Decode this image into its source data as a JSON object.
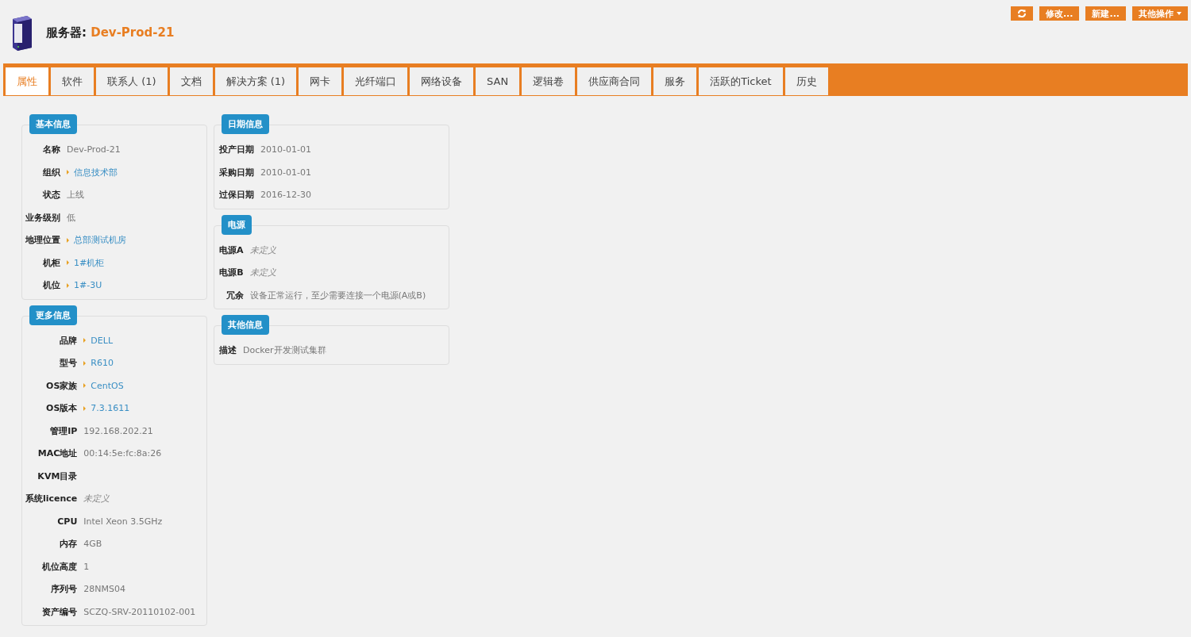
{
  "header": {
    "label": "服务器:",
    "name": "Dev-Prod-21"
  },
  "actions": [
    {
      "kind": "icon"
    },
    {
      "kind": "text",
      "label": "修改..."
    },
    {
      "kind": "text",
      "label": "新建..."
    },
    {
      "kind": "menu",
      "label": "其他操作"
    }
  ],
  "tabs": [
    {
      "label": "属性",
      "selected": true
    },
    {
      "label": "软件",
      "selected": false
    },
    {
      "label": "联系人 (1)",
      "selected": false
    },
    {
      "label": "文档",
      "selected": false
    },
    {
      "label": "解决方案 (1)",
      "selected": false
    },
    {
      "label": "网卡",
      "selected": false
    },
    {
      "label": "光纤端口",
      "selected": false
    },
    {
      "label": "网络设备",
      "selected": false
    },
    {
      "label": "SAN",
      "selected": false
    },
    {
      "label": "逻辑卷",
      "selected": false
    },
    {
      "label": "供应商合同",
      "selected": false
    },
    {
      "label": "服务",
      "selected": false
    },
    {
      "label": "活跃的Ticket",
      "selected": false
    },
    {
      "label": "历史",
      "selected": false
    }
  ],
  "columns": [
    [
      {
        "title": "基本信息",
        "fields": [
          {
            "label": "名称",
            "value": "Dev-Prod-21",
            "kind": "plain"
          },
          {
            "label": "组织",
            "value": "信息技术部",
            "kind": "link"
          },
          {
            "label": "状态",
            "value": "上线",
            "kind": "plain"
          },
          {
            "label": "业务级别",
            "value": "低",
            "kind": "plain"
          },
          {
            "label": "地理位置",
            "value": "总部测试机房",
            "kind": "link"
          },
          {
            "label": "机柜",
            "value": "1#机柜",
            "kind": "link"
          },
          {
            "label": "机位",
            "value": "1#-3U",
            "kind": "link"
          }
        ]
      },
      {
        "title": "更多信息",
        "fields": [
          {
            "label": "品牌",
            "value": "DELL",
            "kind": "link"
          },
          {
            "label": "型号",
            "value": "R610",
            "kind": "link"
          },
          {
            "label": "OS家族",
            "value": "CentOS",
            "kind": "link"
          },
          {
            "label": "OS版本",
            "value": "7.3.1611",
            "kind": "link"
          },
          {
            "label": "管理IP",
            "value": "192.168.202.21",
            "kind": "plain"
          },
          {
            "label": "MAC地址",
            "value": "00:14:5e:fc:8a:26",
            "kind": "plain"
          },
          {
            "label": "KVM目录",
            "kind": "plain"
          },
          {
            "label": "系统licence",
            "value": "未定义",
            "kind": "undefined"
          },
          {
            "label": "CPU",
            "value": "Intel Xeon 3.5GHz",
            "kind": "plain"
          },
          {
            "label": "内存",
            "value": "4GB",
            "kind": "plain"
          },
          {
            "label": "机位高度",
            "value": "1",
            "kind": "plain"
          },
          {
            "label": "序列号",
            "value": "28NMS04",
            "kind": "plain"
          },
          {
            "label": "资产编号",
            "value": "SCZQ-SRV-20110102-001",
            "kind": "plain"
          }
        ]
      }
    ],
    [
      {
        "title": "日期信息",
        "fields": [
          {
            "label": "投产日期",
            "value": "2010-01-01",
            "kind": "plain"
          },
          {
            "label": "采购日期",
            "value": "2010-01-01",
            "kind": "plain"
          },
          {
            "label": "过保日期",
            "value": "2016-12-30",
            "kind": "plain"
          }
        ]
      },
      {
        "title": "电源",
        "fields": [
          {
            "label": "电源A",
            "value": "未定义",
            "kind": "undefined"
          },
          {
            "label": "电源B",
            "value": "未定义",
            "kind": "undefined"
          },
          {
            "label": "冗余",
            "value": "设备正常运行，至少需要连接一个电源(A或B)",
            "kind": "plain"
          }
        ]
      },
      {
        "title": "其他信息",
        "fields": [
          {
            "label": "描述",
            "value": "Docker开发测试集群",
            "kind": "plain"
          }
        ]
      }
    ]
  ]
}
